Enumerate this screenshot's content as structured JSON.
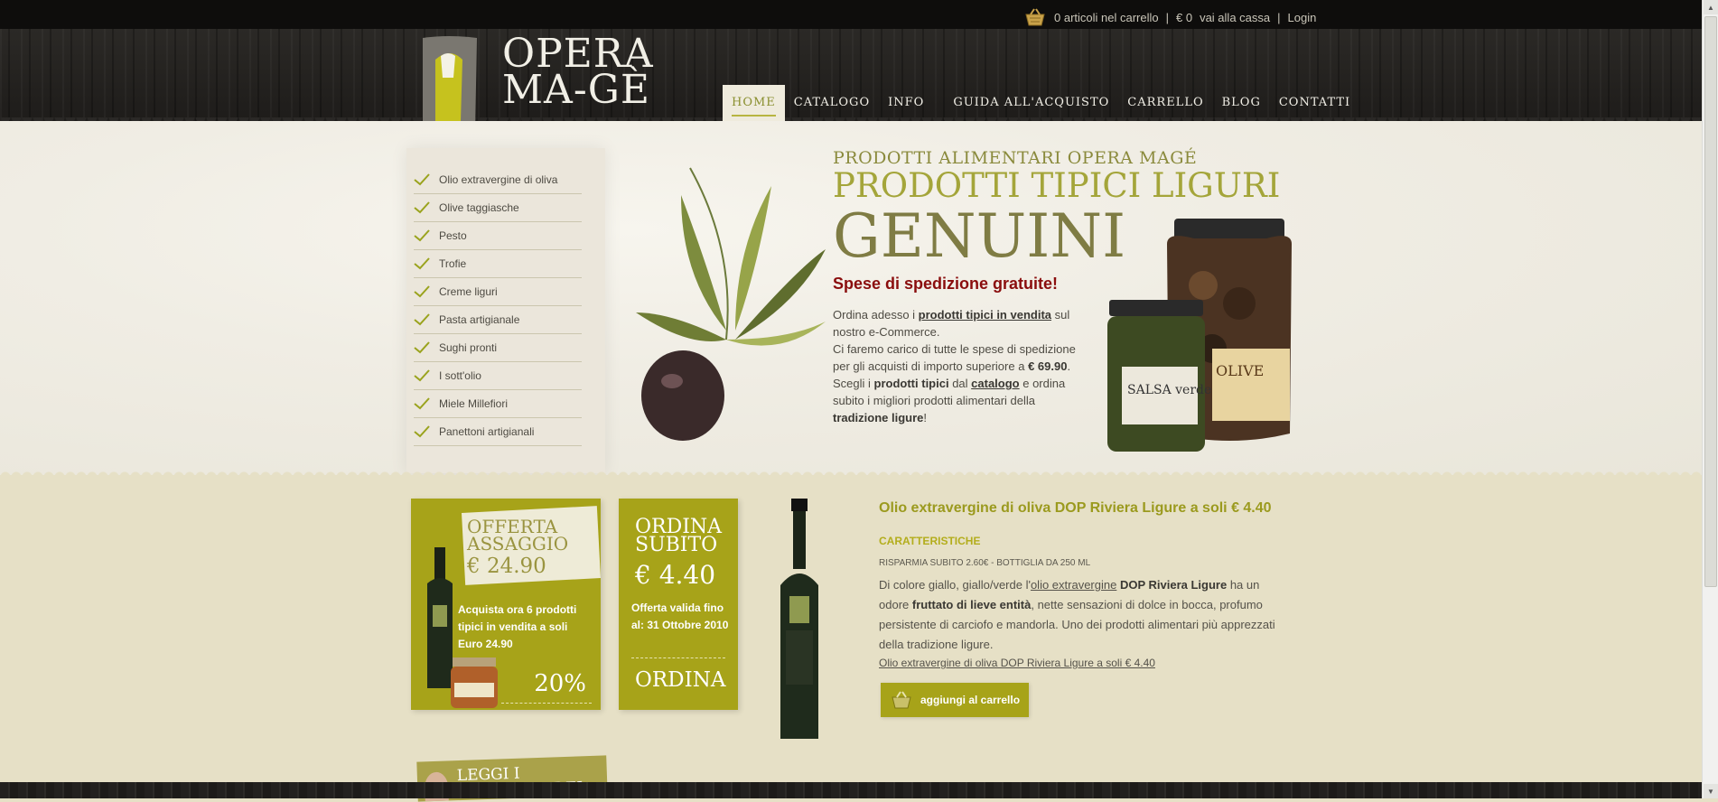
{
  "topbar": {
    "cart_count": "0 articoli nel carrello",
    "cart_total": "€ 0",
    "checkout": "vai alla cassa",
    "login": "Login",
    "separator": "|"
  },
  "brand": {
    "line1": "OPERA",
    "line2": "MA-GÈ"
  },
  "nav": {
    "items": [
      {
        "label": "HOME"
      },
      {
        "label": "CATALOGO"
      },
      {
        "label": "INFO"
      },
      {
        "label": "GUIDA ALL'ACQUISTO"
      },
      {
        "label": "CARRELLO"
      },
      {
        "label": "BLOG"
      },
      {
        "label": "CONTATTI"
      }
    ],
    "active": "HOME"
  },
  "categories": [
    "Olio extravergine di oliva",
    "Olive taggiasche",
    "Pesto",
    "Trofie",
    "Creme liguri",
    "Pasta artigianale",
    "Sughi pronti",
    "I sott'olio",
    "Miele Millefiori",
    "Panettoni artigianali"
  ],
  "hero": {
    "subtitle": "PRODOTTI ALIMENTARI OPERA MAGÉ",
    "title": "PRODOTTI TIPICI LIGURI",
    "big": "GENUINI",
    "shipping": "Spese di spedizione gratuite!",
    "p1_a": "Ordina adesso i ",
    "p1_link": "prodotti tipici in vendita",
    "p1_b": " sul nostro e-Commerce.",
    "p2_a": "Ci faremo carico di tutte le spese di spedizione per gli acquisti di importo superiore a ",
    "p2_amount": "€ 69.90",
    "p2_b": ".",
    "p3_a": "Scegli i ",
    "p3_bold": "prodotti tipici",
    "p3_b": " dal ",
    "p3_link": "catalogo",
    "p3_c": " e ordina subito i migliori prodotti alimentari della ",
    "p3_bold2": "tradizione ligure",
    "p3_d": "!"
  },
  "jars": {
    "label_left": "SALSA verde",
    "label_right": "OLIVE"
  },
  "promo_offer": {
    "title": "OFFERTA ASSAGGIO",
    "price": "€ 24.90",
    "body": "Acquista ora 6 prodotti tipici in vendita a soli Euro 24.90",
    "discount": "20%"
  },
  "promo_order": {
    "title": "ORDINA SUBITO",
    "price": "€ 4.40",
    "body": "Offerta valida fino al: 31 Ottobre 2010",
    "cta": "ORDINA"
  },
  "product": {
    "title": "Olio extravergine di oliva DOP Riviera Ligure a soli € 4.40",
    "section": "CARATTERISTICHE",
    "save": "RISPARMIA SUBITO 2.60€ - BOTTIGLIA DA 250 ML",
    "d1": "Di colore giallo, giallo/verde l'",
    "d_link": "olio extravergine",
    "d2": " ",
    "d_bold1": "DOP Riviera Ligure",
    "d3": " ha un odore ",
    "d_bold2": "fruttato di lieve entità",
    "d4": ", nette sensazioni di dolce in bocca, profumo persistente di carciofo e mandorla. Uno dei prodotti alimentari più apprezzati della tradizione ligure.",
    "link": "Olio extravergine di oliva DOP Riviera Ligure a soli € 4.40",
    "add_to_cart": "aggiungi al carrello"
  },
  "feedback": {
    "label": "LEGGI I FEEDBACK DEI NOSTRI CLIENTI"
  },
  "colors": {
    "olive": "#a7a319",
    "dark_red": "#8a0d0d",
    "wood": "#2b2926",
    "cream": "#e6e0c6"
  }
}
